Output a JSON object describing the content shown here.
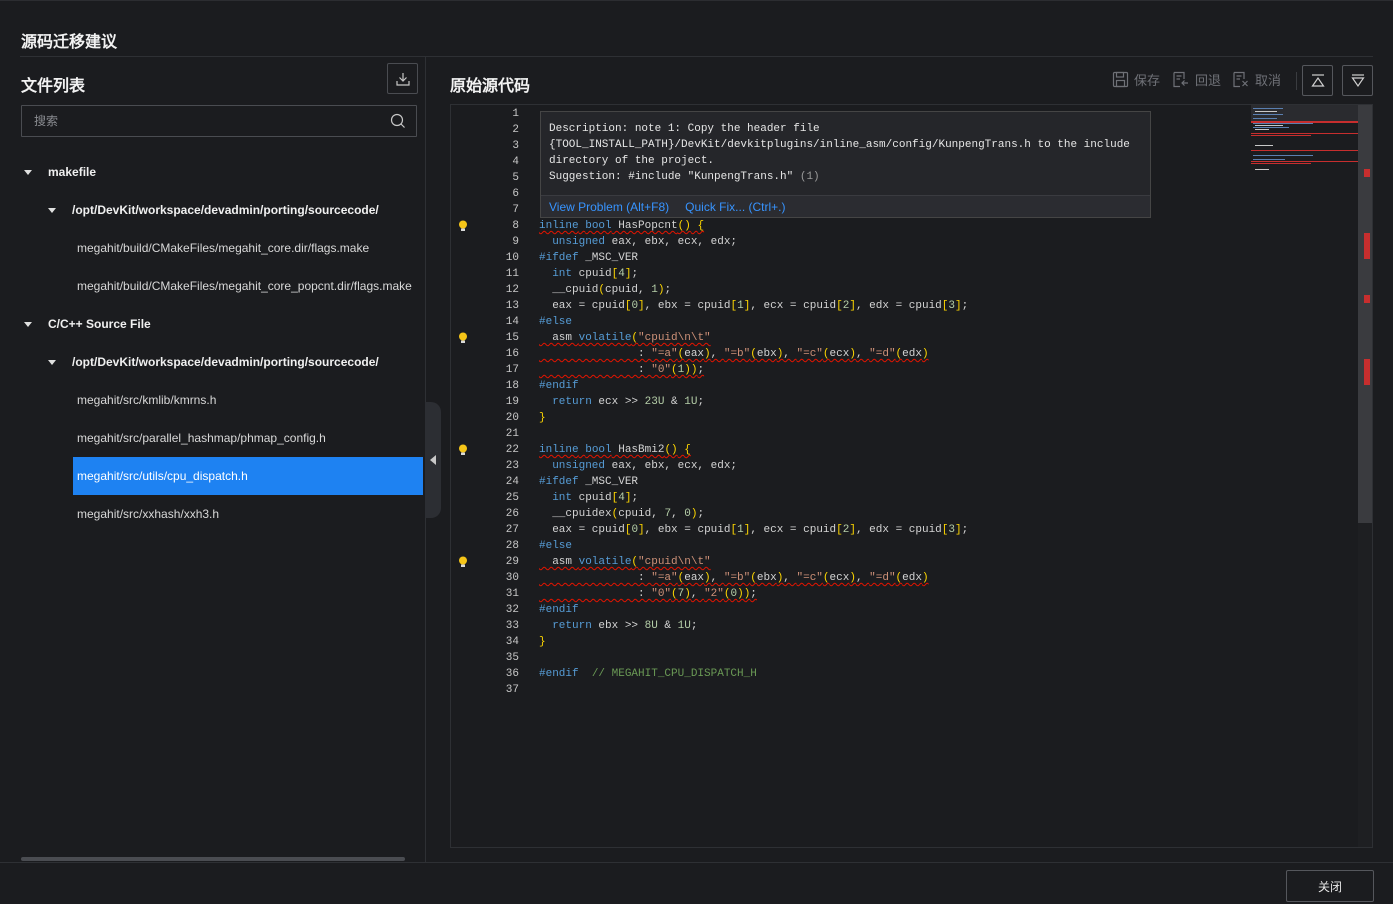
{
  "dialog": {
    "title": "源码迁移建议",
    "close_label": "关闭"
  },
  "file_list": {
    "title": "文件列表",
    "search_placeholder": "搜索",
    "groups": [
      {
        "label": "makefile",
        "path": "/opt/DevKit/workspace/devadmin/porting/sourcecode/",
        "files": [
          "megahit/build/CMakeFiles/megahit_core.dir/flags.make",
          "megahit/build/CMakeFiles/megahit_core_popcnt.dir/flags.make"
        ]
      },
      {
        "label": "C/C++ Source File",
        "path": "/opt/DevKit/workspace/devadmin/porting/sourcecode/",
        "files": [
          "megahit/src/kmlib/kmrns.h",
          "megahit/src/parallel_hashmap/phmap_config.h",
          "megahit/src/utils/cpu_dispatch.h",
          "megahit/src/xxhash/xxh3.h"
        ]
      }
    ],
    "selected_file": "megahit/src/utils/cpu_dispatch.h"
  },
  "editor": {
    "title": "原始源代码",
    "toolbar": {
      "save": "保存",
      "revert": "回退",
      "cancel": "取消"
    },
    "hover": {
      "description": "Description: note 1: Copy the header file\n{TOOL_INSTALL_PATH}/DevKit/devkitplugins/inline_asm/config/KunpengTrans.h to the include\ndirectory of the project.\nSuggestion: #include \"KunpengTrans.h\"",
      "count": " (1)",
      "view_problem": "View Problem (Alt+F8)",
      "quick_fix": "Quick Fix... (Ctrl+.)"
    },
    "line_numbers": [
      "1",
      "2",
      "3",
      "4",
      "5",
      "6",
      "7",
      "8",
      "9",
      "10",
      "11",
      "12",
      "13",
      "14",
      "15",
      "16",
      "17",
      "18",
      "19",
      "20",
      "21",
      "22",
      "23",
      "24",
      "25",
      "26",
      "27",
      "28",
      "29",
      "30",
      "31",
      "32",
      "33",
      "34",
      "35",
      "36",
      "37"
    ],
    "bulb_lines": [
      8,
      15,
      22,
      29
    ]
  },
  "colors": {
    "accent": "#1e82f2",
    "error": "#e51400",
    "warning": "#cca700"
  }
}
